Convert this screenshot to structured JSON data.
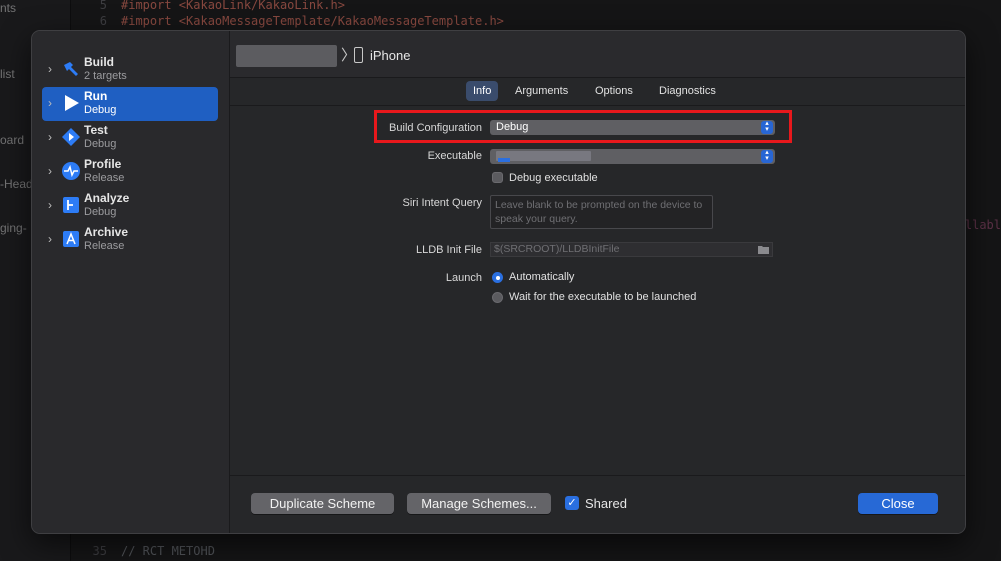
{
  "background": {
    "navigator_fragments": [
      "nts",
      "list",
      "oard",
      "-Head",
      "ging-"
    ],
    "code_lines": [
      {
        "number": "5",
        "text": "#import <KakaoLink/KakaoLink.h>"
      },
      {
        "number": "6",
        "text": "#import <KakaoMessageTemplate/KakaoMessageTemplate.h>"
      },
      {
        "number": "35",
        "text": "// RCT METOHD"
      }
    ],
    "right_fragment": "llabl"
  },
  "sidebar": {
    "actions": [
      {
        "name": "Build",
        "subtitle": "2 targets",
        "icon": "hammer-icon",
        "selected": false
      },
      {
        "name": "Run",
        "subtitle": "Debug",
        "icon": "play-icon",
        "selected": true
      },
      {
        "name": "Test",
        "subtitle": "Debug",
        "icon": "test-diamond-icon",
        "selected": false
      },
      {
        "name": "Profile",
        "subtitle": "Release",
        "icon": "waveform-icon",
        "selected": false
      },
      {
        "name": "Analyze",
        "subtitle": "Debug",
        "icon": "analyze-icon",
        "selected": false
      },
      {
        "name": "Archive",
        "subtitle": "Release",
        "icon": "archive-icon",
        "selected": false
      }
    ]
  },
  "header": {
    "device_name": "iPhone"
  },
  "tabs": [
    {
      "label": "Info",
      "active": true
    },
    {
      "label": "Arguments",
      "active": false
    },
    {
      "label": "Options",
      "active": false
    },
    {
      "label": "Diagnostics",
      "active": false
    }
  ],
  "form": {
    "build_configuration": {
      "label": "Build Configuration",
      "value": "Debug"
    },
    "executable": {
      "label": "Executable"
    },
    "debug_executable": {
      "label": "Debug executable",
      "checked": false
    },
    "siri_intent_query": {
      "label": "Siri Intent Query",
      "placeholder": "Leave blank to be prompted on the device to speak your query."
    },
    "lldb_init_file": {
      "label": "LLDB Init File",
      "placeholder": "$(SRCROOT)/LLDBInitFile"
    },
    "launch": {
      "label": "Launch",
      "options": [
        {
          "label": "Automatically",
          "selected": true
        },
        {
          "label": "Wait for the executable to be launched",
          "selected": false
        }
      ]
    }
  },
  "footer": {
    "duplicate_scheme": "Duplicate Scheme",
    "manage_schemes": "Manage Schemes...",
    "shared_label": "Shared",
    "shared_checked": true,
    "close": "Close"
  },
  "colors": {
    "accent": "#2769d6",
    "selection": "#1f5fc2",
    "highlight_box": "#e8181c"
  }
}
